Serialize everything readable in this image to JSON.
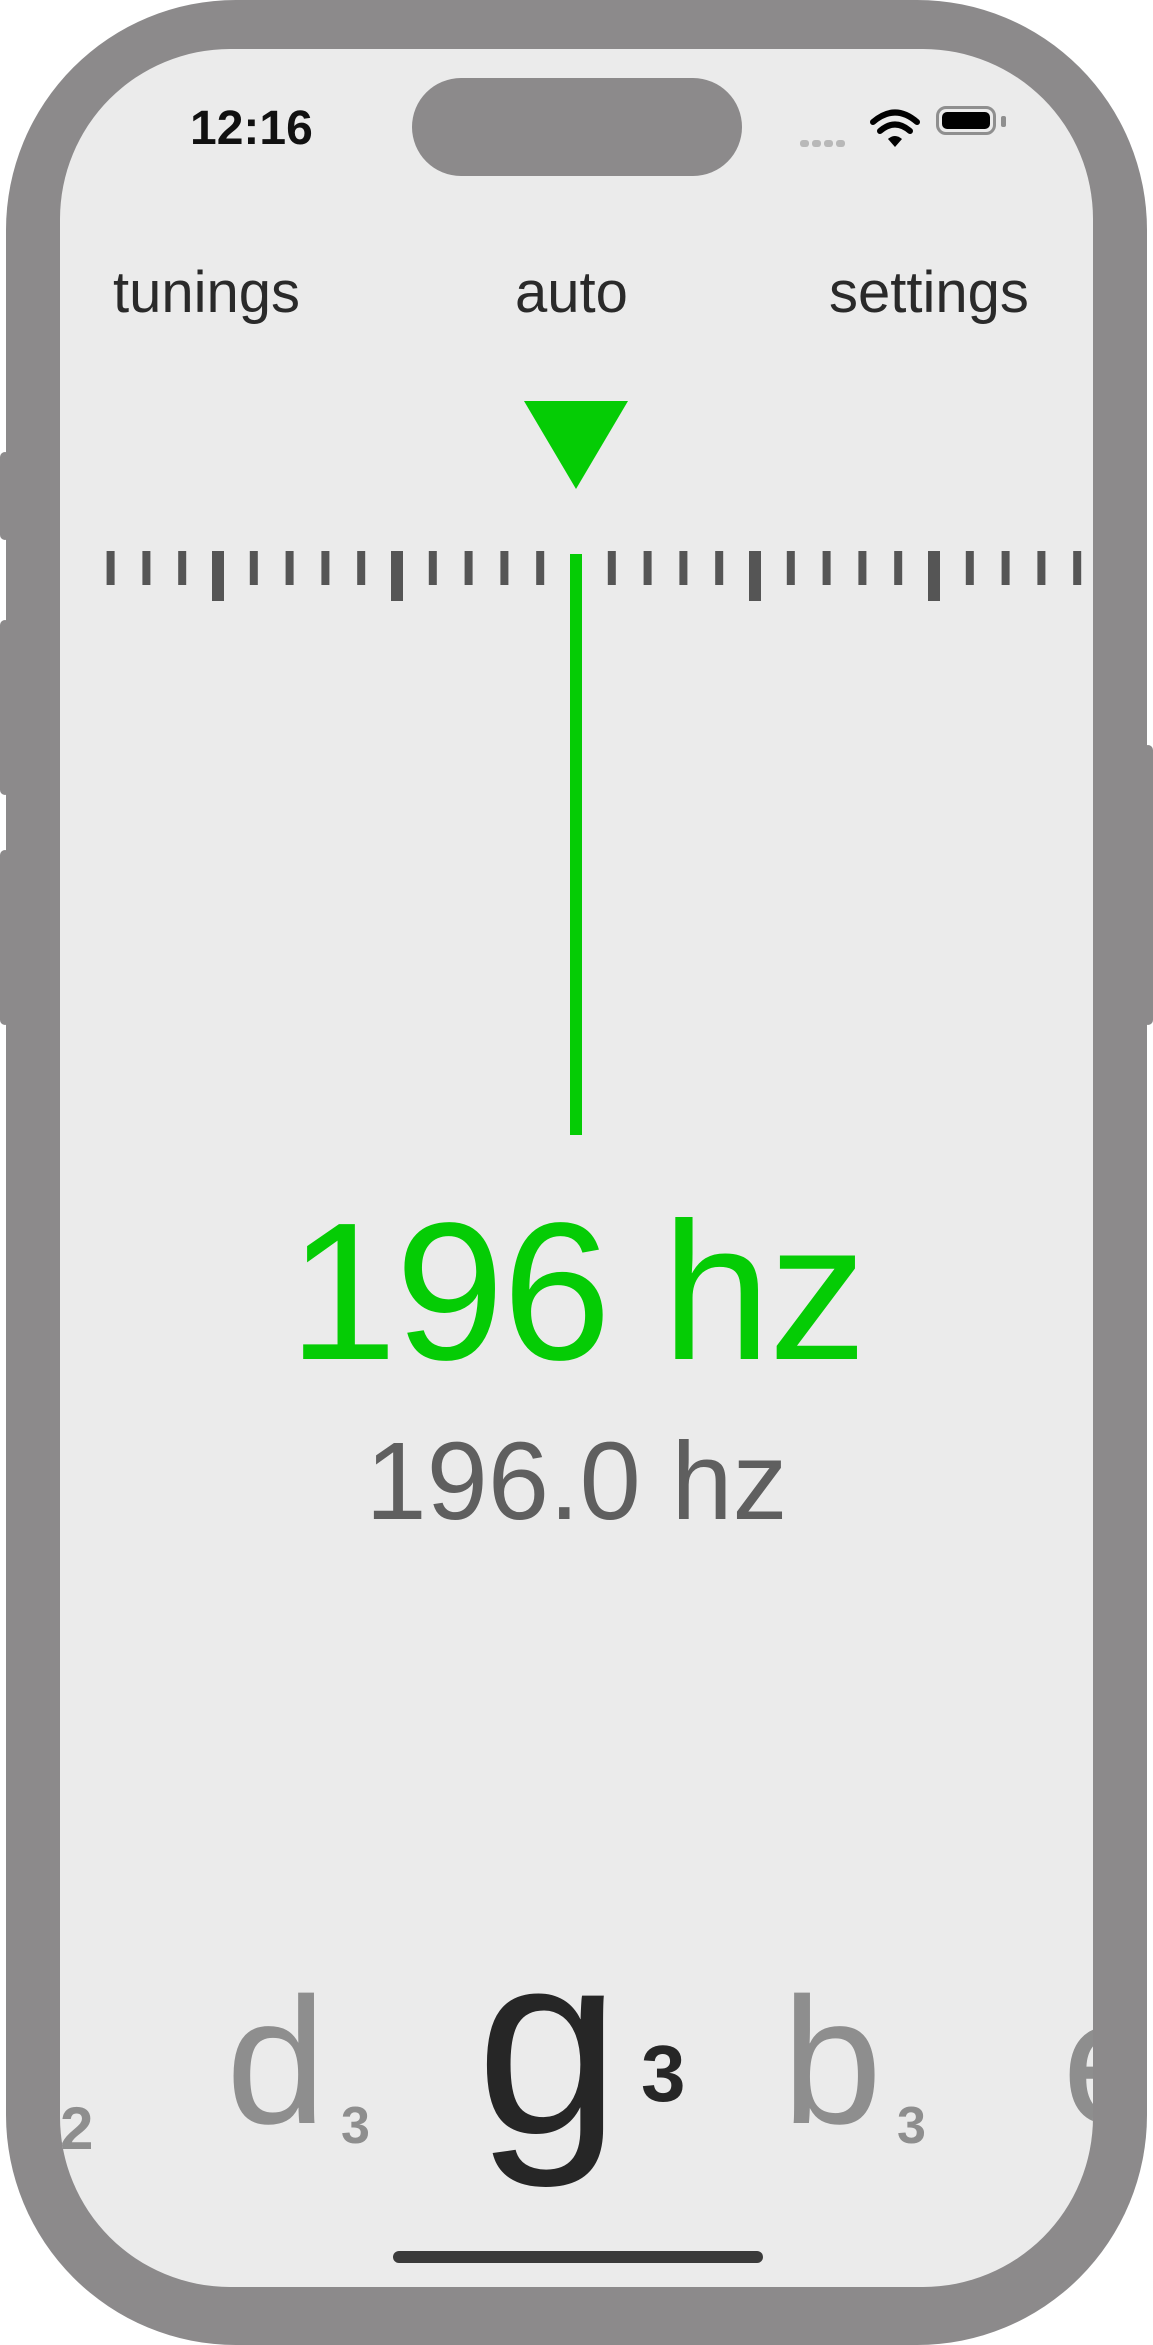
{
  "status_bar": {
    "time": "12:16",
    "icons": [
      "cellular-signal-icon",
      "wifi-icon",
      "battery-icon"
    ]
  },
  "nav": {
    "tunings": "tunings",
    "auto": "auto",
    "settings": "settings"
  },
  "gauge": {
    "pointer_color": "#05cc05",
    "needle_color": "#05cc05",
    "tick_color": "#555555",
    "cents_offset": 0
  },
  "frequency": {
    "detected": "196 hz",
    "precise": "196.0 hz"
  },
  "notes": [
    {
      "letter": "",
      "octave": "2",
      "state": "inactive"
    },
    {
      "letter": "d",
      "octave": "3",
      "state": "inactive"
    },
    {
      "letter": "g",
      "octave": "3",
      "state": "active"
    },
    {
      "letter": "b",
      "octave": "3",
      "state": "inactive"
    },
    {
      "letter": "e",
      "octave": "",
      "state": "inactive"
    }
  ],
  "colors": {
    "accent": "#05cc05",
    "background": "#ebebeb",
    "frame": "#8c8a8b"
  }
}
